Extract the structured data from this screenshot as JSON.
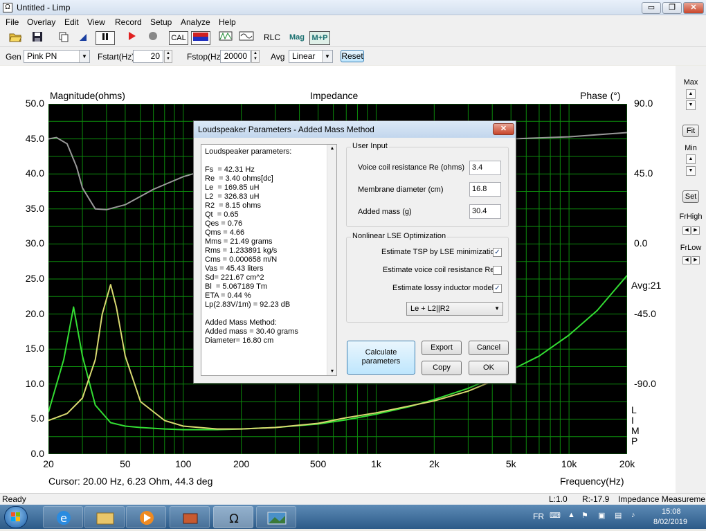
{
  "window": {
    "title": "Untitled - Limp",
    "app_icon_glyph": "Ω",
    "minimize": "▭",
    "restore": "❐",
    "close": "✕"
  },
  "menu": [
    "File",
    "Overlay",
    "Edit",
    "View",
    "Record",
    "Setup",
    "Analyze",
    "Help"
  ],
  "toolbar": {
    "cal": "CAL",
    "rlc": "RLC",
    "mag": "Mag",
    "mp": "M+P",
    "icons": [
      "open-folder-icon",
      "save-icon",
      "copy-icon",
      "cursor-icon",
      "pause-icon",
      "record-icon",
      "stop-icon",
      "cal-button",
      "color-icon",
      "waveform-icon",
      "sine-icon"
    ]
  },
  "controls": {
    "gen_label": "Gen",
    "gen_value": "Pink PN",
    "fstart_label": "Fstart(Hz)",
    "fstart_value": "20",
    "fstop_label": "Fstop(Hz)",
    "fstop_value": "20000",
    "avg_label": "Avg",
    "avg_value": "Linear",
    "reset_label": "Reset"
  },
  "chart_data": {
    "type": "line",
    "title": "Impedance",
    "ylabel": "Magnitude(ohms)",
    "y2label": "Phase (°)",
    "xlabel": "Frequency(Hz)",
    "xscale": "log",
    "xlim": [
      20,
      20000
    ],
    "ylim": [
      0,
      50
    ],
    "y2lim": [
      -135,
      90
    ],
    "x_ticks": [
      "20",
      "50",
      "100",
      "200",
      "500",
      "1k",
      "2k",
      "5k",
      "10k",
      "20k"
    ],
    "x_tick_values": [
      20,
      50,
      100,
      200,
      500,
      1000,
      2000,
      5000,
      10000,
      20000
    ],
    "y_ticks": [
      "50.0",
      "45.0",
      "40.0",
      "35.0",
      "30.0",
      "25.0",
      "20.0",
      "15.0",
      "10.0",
      "5.0",
      "0.0"
    ],
    "y2_ticks": [
      "90.0",
      "45.0",
      "0.0",
      "-45.0",
      "-90.0"
    ],
    "avg_label": "Avg:21",
    "limp_label": [
      "L",
      "I",
      "M",
      "P"
    ],
    "background": "#000000",
    "grid": true,
    "series": [
      {
        "color": "#33dd33",
        "x": [
          20,
          24,
          27,
          30,
          35,
          42,
          50,
          60,
          80,
          100,
          150,
          200,
          300,
          500,
          700,
          1000,
          1500,
          2000,
          3000,
          5000,
          7000,
          10000,
          14000,
          20000
        ],
        "y": [
          6.0,
          13.5,
          21.0,
          14.0,
          7.0,
          4.5,
          4.0,
          3.8,
          3.6,
          3.5,
          3.5,
          3.6,
          3.8,
          4.3,
          4.9,
          5.7,
          6.8,
          7.8,
          9.4,
          12.0,
          14.0,
          17.0,
          20.5,
          25.5
        ]
      },
      {
        "color": "#d8d870",
        "x": [
          20,
          25,
          30,
          35,
          38,
          42,
          45,
          50,
          60,
          80,
          100,
          150,
          200,
          300,
          500,
          700,
          1000,
          1500,
          2000,
          3000,
          5000
        ],
        "y": [
          4.8,
          5.8,
          8.0,
          13.5,
          20.0,
          24.2,
          21.0,
          14.0,
          7.5,
          4.8,
          4.0,
          3.6,
          3.6,
          3.8,
          4.4,
          5.2,
          5.9,
          6.9,
          7.6,
          9.0,
          11.5
        ]
      },
      {
        "color": "#9a9a9a",
        "x": [
          20,
          22,
          25,
          28,
          30,
          35,
          40,
          50,
          70,
          100,
          150,
          200,
          300,
          500,
          1000,
          2000,
          5000,
          10000,
          20000
        ],
        "y": [
          45.0,
          45.2,
          44.3,
          41.0,
          38.0,
          35.0,
          34.9,
          35.6,
          37.8,
          39.6,
          41.0,
          41.9,
          42.8,
          43.5,
          44.2,
          44.7,
          45.0,
          45.3,
          45.9
        ]
      }
    ]
  },
  "cursor_text": "Cursor: 20.00 Hz, 6.23 Ohm, 44.3 deg",
  "right_panel": {
    "max": "Max",
    "fit": "Fit",
    "min": "Min",
    "set": "Set",
    "frhigh": "FrHigh",
    "frlow": "FrLow",
    "up": "▲",
    "down": "▼",
    "left": "◀",
    "right": "▶"
  },
  "dialog": {
    "title": "Loudspeaker Parameters - Added Mass Method",
    "close": "✕",
    "results": [
      "Loudspeaker parameters:",
      "",
      "Fs  = 42.31 Hz",
      "Re  = 3.40 ohms[dc]",
      "Le  = 169.85 uH",
      "L2  = 326.83 uH",
      "R2  = 8.15 ohms",
      "Qt  = 0.65",
      "Qes = 0.76",
      "Qms = 4.66",
      "Mms = 21.49 grams",
      "Rms = 1.233891 kg/s",
      "Cms = 0.000658 m/N",
      "Vas = 45.43 liters",
      "Sd= 221.67 cm^2",
      "Bl  = 5.067189 Tm",
      "ETA = 0.44 %",
      "Lp(2.83V/1m) = 92.23 dB",
      "",
      "Added Mass Method:",
      "Added mass = 30.40 grams",
      "Diameter= 16.80 cm"
    ],
    "user_input": {
      "title": "User Input",
      "re_label": "Voice coil resistance Re (ohms)",
      "re_value": "3.4",
      "diam_label": "Membrane diameter (cm)",
      "diam_value": "16.8",
      "mass_label": "Added mass (g)",
      "mass_value": "30.4"
    },
    "lse": {
      "title": "Nonlinear LSE Optimization",
      "opt1": "Estimate TSP by LSE minimization",
      "opt1_checked": "✓",
      "opt2": "Estimate voice coil resistance Re",
      "opt2_checked": "",
      "opt3": "Estimate lossy inductor model",
      "opt3_checked": "✓",
      "model": "Le + L2||R2"
    },
    "buttons": {
      "calculate": "Calculate parameters",
      "export": "Export",
      "cancel": "Cancel",
      "copy": "Copy",
      "ok": "OK"
    }
  },
  "status": {
    "ready": "Ready",
    "l": "L:1.0",
    "r": "R:-17.9",
    "mode": "Impedance Measureme"
  },
  "taskbar": {
    "lang": "FR",
    "time": "15:08",
    "date": "8/02/2019"
  }
}
